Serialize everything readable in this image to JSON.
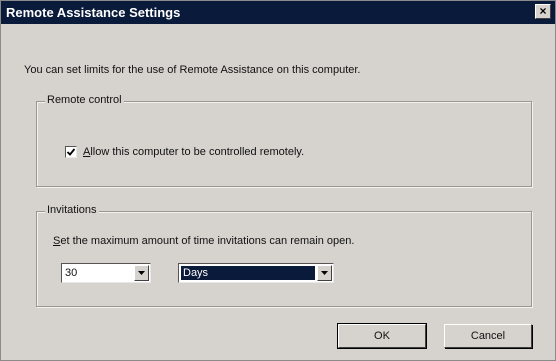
{
  "window": {
    "title": "Remote Assistance Settings",
    "close_symbol": "×"
  },
  "intro_text": "You can set limits for the use of Remote Assistance on this computer.",
  "remote_control": {
    "group_label": "Remote control",
    "checkbox_access_key": "A",
    "checkbox_label_rest": "llow this computer to be controlled remotely.",
    "checked": true
  },
  "invitations": {
    "group_label": "Invitations",
    "text_access_key": "S",
    "text_rest": "et the maximum amount of time invitations can remain open.",
    "amount_value": "30",
    "unit_value": "Days"
  },
  "buttons": {
    "ok_label": "OK",
    "cancel_label": "Cancel"
  },
  "icons": {
    "close": "close-icon",
    "check": "checkmark-icon",
    "dropdown": "chevron-down-icon"
  },
  "colors": {
    "titlebar": "#0a1a3a",
    "dialog_face": "#d6d3ce",
    "selection": "#0a1a3a"
  }
}
